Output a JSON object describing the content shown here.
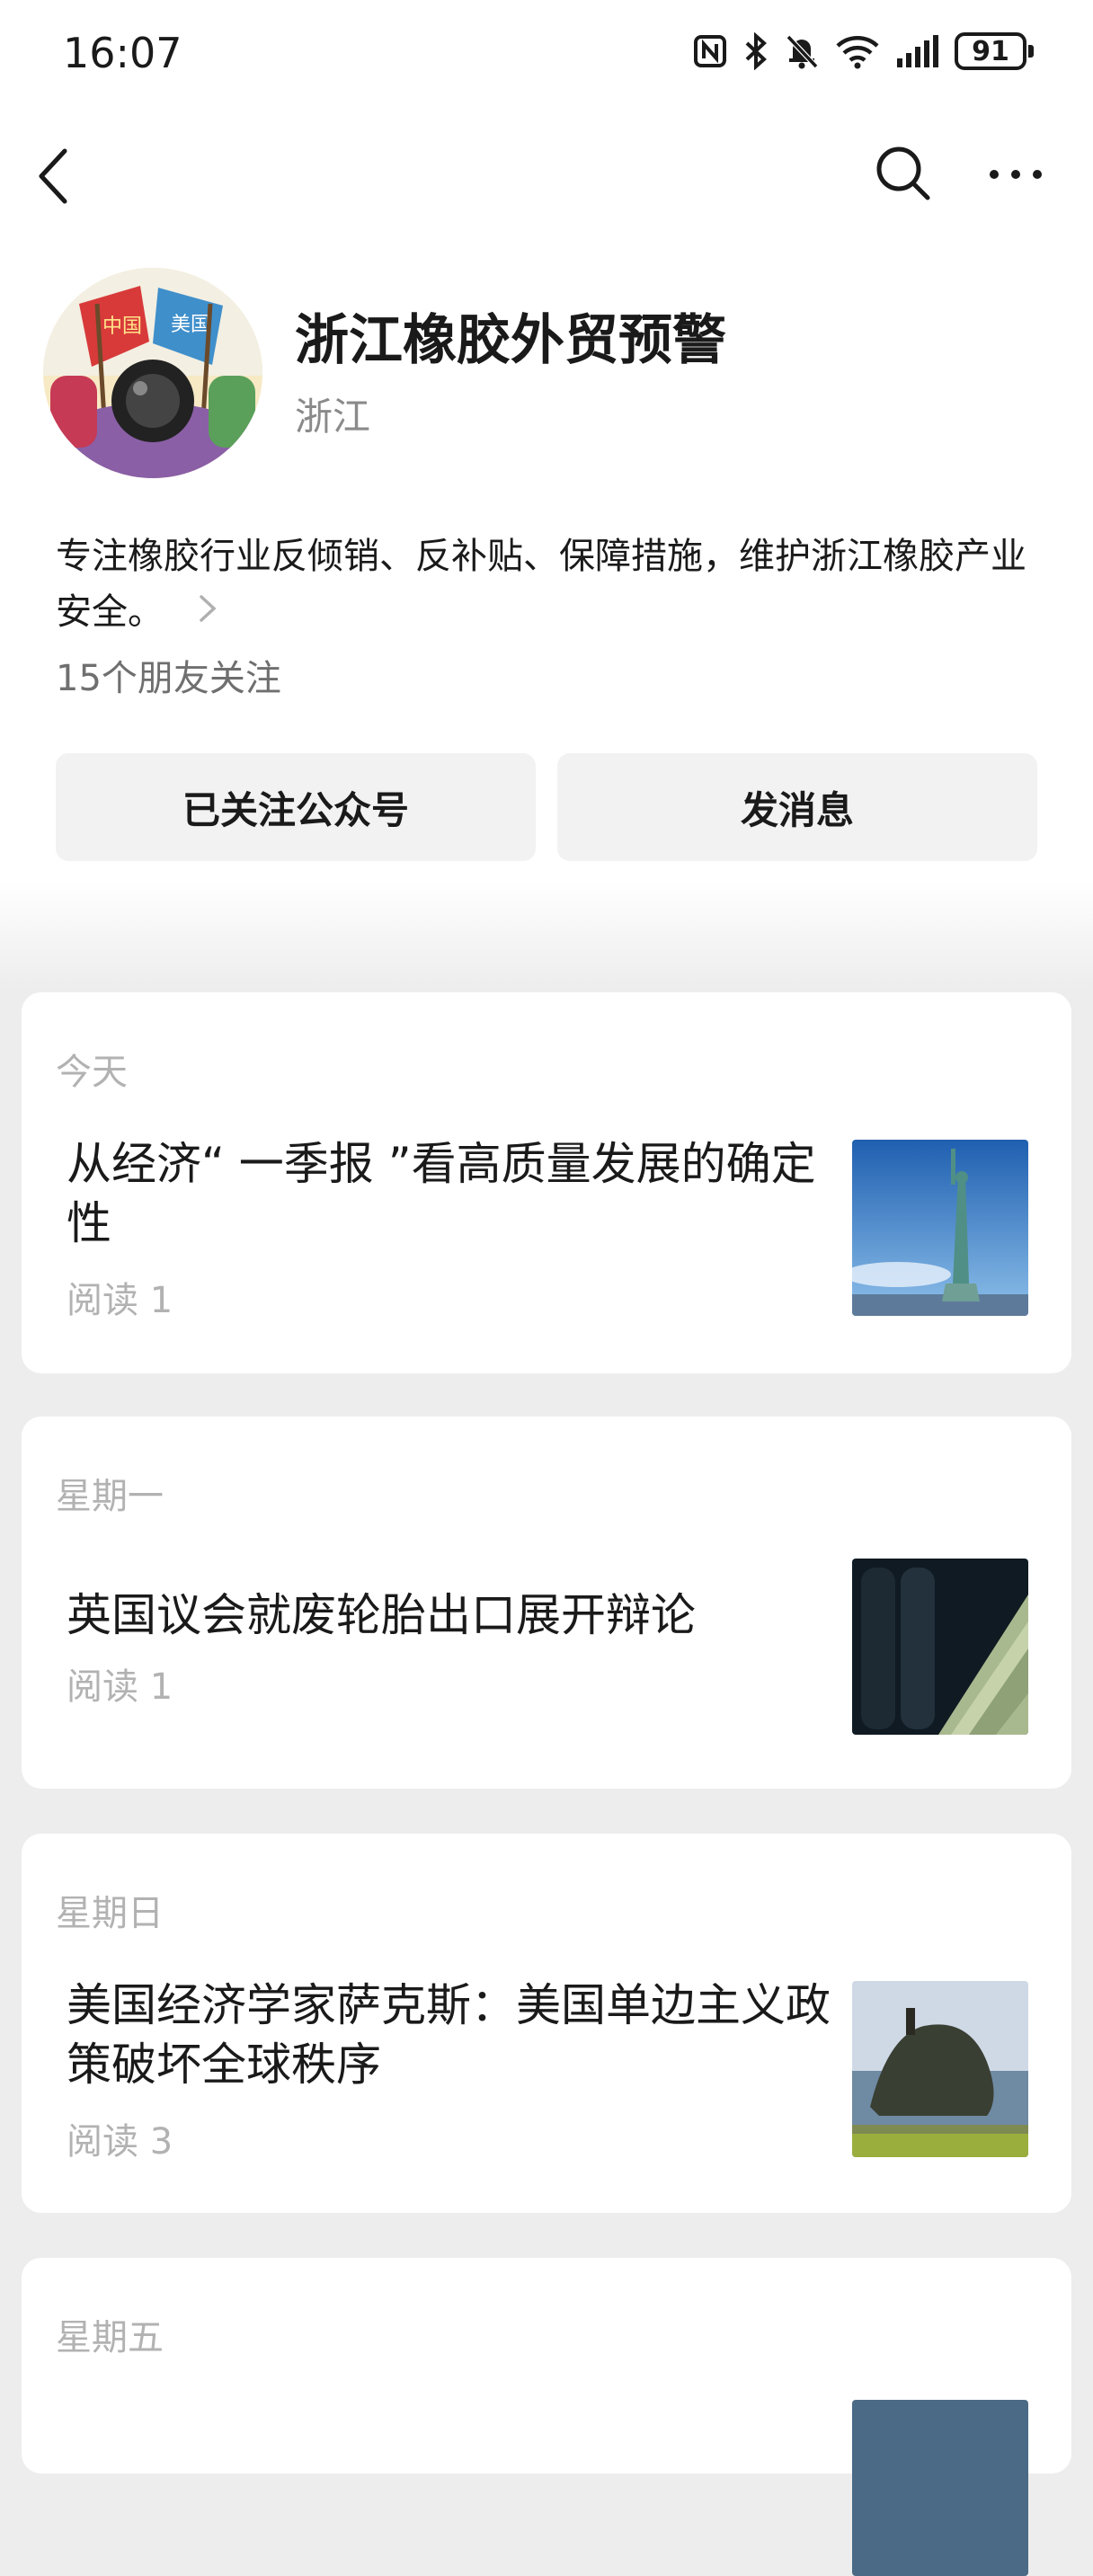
{
  "status_bar": {
    "time": "16:07",
    "battery": "91",
    "icons": [
      "nfc-icon",
      "bluetooth-icon",
      "mute-bell-icon",
      "wifi-icon",
      "signal-icon",
      "battery-icon"
    ]
  },
  "nav": {
    "icons": [
      "back-chevron-icon",
      "search-icon",
      "more-icon"
    ]
  },
  "profile": {
    "name": "浙江橡胶外贸预警",
    "region": "浙江",
    "description": "专注橡胶行业反倾销、反补贴、保障措施，维护浙江橡胶产业安全。",
    "friends_follow": "15个朋友关注",
    "avatar_flags": [
      "中国",
      "美国"
    ]
  },
  "actions": {
    "follow_label": "已关注公众号",
    "message_label": "发消息"
  },
  "articles": [
    {
      "day": "今天",
      "title": "从经济“ 一季报 ”看高质量发展的确定性",
      "reads": "阅读 1",
      "thumb": "statue-of-liberty-image"
    },
    {
      "day": "星期一",
      "title": "英国议会就废轮胎出口展开辩论",
      "reads": "阅读 1",
      "thumb": "tires-and-dollars-image"
    },
    {
      "day": "星期日",
      "title": "美国经济学家萨克斯：美国单边主义政策破坏全球秩序",
      "reads": "阅读 3",
      "thumb": "sea-temple-image"
    },
    {
      "day": "星期五"
    }
  ],
  "colors": {
    "background": "#ededed",
    "card": "#ffffff",
    "muted_text": "#b2b2b2",
    "button_bg": "#f2f2f2"
  }
}
